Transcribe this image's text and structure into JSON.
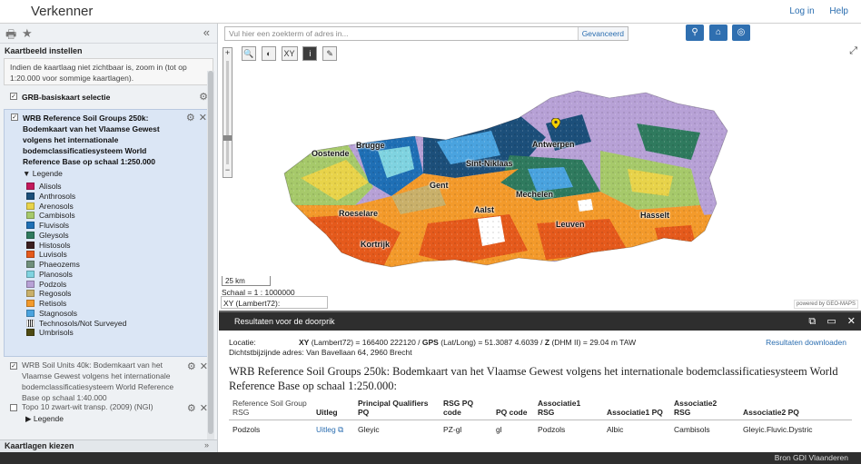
{
  "header": {
    "title": "Verkenner",
    "links": [
      "Log in",
      "Help"
    ]
  },
  "left_panel": {
    "icons": [
      "print-icon",
      "star-icon"
    ],
    "collapse_glyph": "«",
    "title": "Kaartbeeld instellen",
    "info": "Indien de kaartlaag niet zichtbaar is, zoom in (tot op 1:20.000 voor sommige kaartlagen).",
    "layers": [
      {
        "title": "GRB-basiskaart selectie",
        "checked": true
      },
      {
        "title": "WRB Reference Soil Groups 250k: Bodemkaart van het Vlaamse Gewest volgens het internationale bodemclassificatiesysteem World Reference Base op schaal 1:250.000",
        "checked": true,
        "legend_label": "Legende"
      },
      {
        "title": "WRB Soil Units 40k: Bodemkaart van het Vlaamse Gewest volgens het internationale bodemclassificatiesysteem World Reference Base op schaal 1:40.000",
        "checked": true,
        "legend_label": "Legende"
      },
      {
        "title": "Topo 10 zwart-wit transp. (2009) (NGI)",
        "checked": false,
        "legend_label": "Legende"
      }
    ],
    "legend_items": [
      {
        "label": "Alisols",
        "color": "#c2185b"
      },
      {
        "label": "Anthrosols",
        "color": "#1c4f7a"
      },
      {
        "label": "Arenosols",
        "color": "#e8d34a"
      },
      {
        "label": "Cambisols",
        "color": "#a6c96a"
      },
      {
        "label": "Fluvisols",
        "color": "#1f6fb5"
      },
      {
        "label": "Gleysols",
        "color": "#2f7a5e"
      },
      {
        "label": "Histosols",
        "color": "#3b1f1f"
      },
      {
        "label": "Luvisols",
        "color": "#e55a1c"
      },
      {
        "label": "Phaeozems",
        "color": "#6f8f7b"
      },
      {
        "label": "Planosols",
        "color": "#7fd3e0"
      },
      {
        "label": "Podzols",
        "color": "#b7a1d6"
      },
      {
        "label": "Regosols",
        "color": "#c9b06a"
      },
      {
        "label": "Retisols",
        "color": "#f39a2b"
      },
      {
        "label": "Stagnosols",
        "color": "#4aa3df"
      },
      {
        "label": "Technosols/Not Surveyed",
        "color": "#ffffff"
      },
      {
        "label": "Umbrisols",
        "color": "#4e4a12"
      }
    ],
    "bottom": {
      "label": "Kaartlagen kiezen",
      "chevron": "»"
    }
  },
  "map": {
    "search_placeholder": "Vul hier een zoekterm of adres in...",
    "advanced_label": "Gevanceerd",
    "tools": [
      "🔍",
      "◐",
      "XY",
      "i",
      "✎"
    ],
    "zoom_in": "+",
    "zoom_out": "−",
    "expand_glyph": "⤢",
    "scale_bar_label": "25 km",
    "scale_text": "Schaal = 1 : 1000000",
    "xy_text": "XY (Lambert72):",
    "attribution": "powered by GEO-MAPS",
    "cities": [
      "Oostende",
      "Brugge",
      "Antwerpen",
      "Sint-Niklaas",
      "Gent",
      "Mechelen",
      "Roeselare",
      "Aalst",
      "Leuven",
      "Hasselt",
      "Kortrijk"
    ]
  },
  "results": {
    "bar_title": "Resultaten voor de doorprik",
    "controls": [
      "⧉",
      "▭",
      "✕"
    ],
    "location_label": "Locatie:",
    "xy_label": "XY",
    "xy_sys": "(Lambert72) = 166400 222120 /",
    "gps_label": "GPS",
    "gps_sys": "(Lat/Long) = 51.3087 4.6039 /",
    "z_label": "Z",
    "z_sys": "(DHM II) = 29.04 m TAW",
    "address_label": "Dichtstbijzijnde adres:",
    "address": "Van Bavellaan 64, 2960 Brecht",
    "download_label": "Resultaten downloaden",
    "layer_title": "WRB Reference Soil Groups 250k: Bodemkaart van het Vlaamse Gewest volgens het internationale bodemclassificatiesysteem World Reference Base op schaal 1:250.000:",
    "columns": [
      "Reference Soil Group RSG",
      "Uitleg",
      "Principal Qualifiers PQ",
      "RSG PQ code",
      "PQ code",
      "Associatie1 RSG",
      "Associatie1 PQ",
      "Associatie2 RSG",
      "Associatie2 PQ"
    ],
    "rows": [
      [
        "Podzols",
        "Uitleg",
        "Gleyic",
        "PZ-gl",
        "gl",
        "Podzols",
        "Albic",
        "Cambisols",
        "Gleyic.Fluvic.Dystric"
      ]
    ]
  },
  "footer": {
    "text": "Bron GDI Vlaanderen"
  }
}
